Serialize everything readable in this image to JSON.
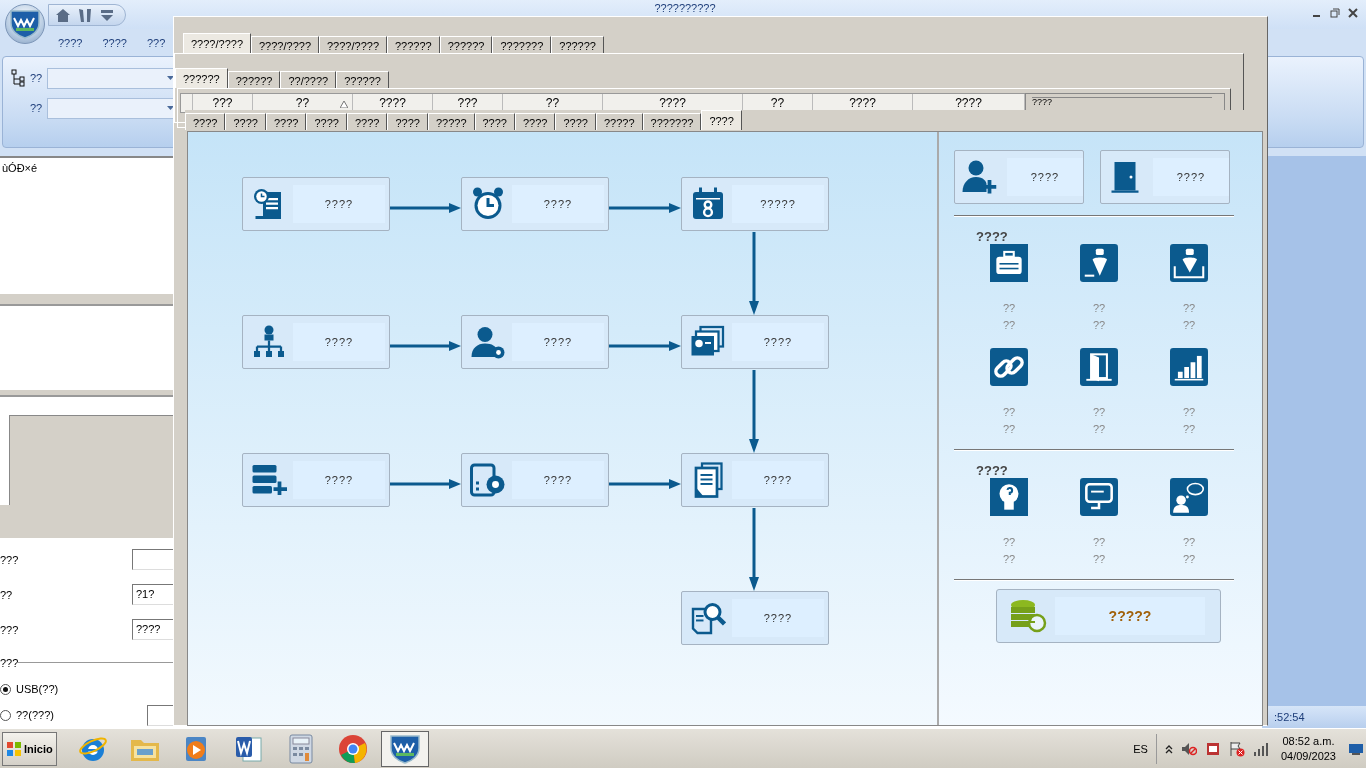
{
  "app": {
    "title": "??????????",
    "menu_tabs": [
      "????",
      "????",
      "???"
    ],
    "ribbon_fields": [
      {
        "label": "??"
      },
      {
        "label": "??"
      }
    ],
    "list_text": "ùÓĐ×é",
    "form_rows": [
      {
        "label": "???"
      },
      {
        "label": "??",
        "value": "?1?"
      },
      {
        "label": "???",
        "value": "????"
      }
    ],
    "radio_group": {
      "title": "???",
      "options": [
        {
          "label": "USB(??)",
          "selected": true
        },
        {
          "label": "??(???)",
          "selected": false
        }
      ]
    },
    "status_time": ":52:54"
  },
  "dialog": {
    "tabs": [
      {
        "label": "????/????",
        "selected": true
      },
      {
        "label": "????/????",
        "selected": false
      },
      {
        "label": "????/????",
        "selected": false
      },
      {
        "label": "??????",
        "selected": false
      },
      {
        "label": "??????",
        "selected": false
      },
      {
        "label": "???????",
        "selected": false
      },
      {
        "label": "??????",
        "selected": false
      }
    ],
    "subtabs": [
      {
        "label": "??????",
        "selected": true
      },
      {
        "label": "??????",
        "selected": false
      },
      {
        "label": "??/????",
        "selected": false
      },
      {
        "label": "??????",
        "selected": false
      }
    ],
    "grid_columns": [
      {
        "label": "???",
        "sorted": false
      },
      {
        "label": "??",
        "sorted": true
      },
      {
        "label": "????",
        "sorted": false
      },
      {
        "label": "???",
        "sorted": false
      },
      {
        "label": "??",
        "sorted": false
      },
      {
        "label": "????",
        "sorted": false
      },
      {
        "label": "??",
        "sorted": false
      },
      {
        "label": "????",
        "sorted": false
      },
      {
        "label": "????",
        "sorted": false
      }
    ],
    "group_label": "????",
    "page_tabs": [
      {
        "label": "????",
        "selected": false
      },
      {
        "label": "????",
        "selected": false
      },
      {
        "label": "????",
        "selected": false
      },
      {
        "label": "????",
        "selected": false
      },
      {
        "label": "????",
        "selected": false
      },
      {
        "label": "????",
        "selected": false
      },
      {
        "label": "?????",
        "selected": false
      },
      {
        "label": "????",
        "selected": false
      },
      {
        "label": "????",
        "selected": false
      },
      {
        "label": "????",
        "selected": false
      },
      {
        "label": "?????",
        "selected": false
      },
      {
        "label": "???????",
        "selected": false
      },
      {
        "label": "????",
        "selected": true
      }
    ],
    "flow_nodes": [
      {
        "kind": "clock-scroll",
        "label": "????"
      },
      {
        "kind": "alarm",
        "label": "????"
      },
      {
        "kind": "calendar",
        "label": "?????"
      },
      {
        "kind": "org",
        "label": "????"
      },
      {
        "kind": "user-gear",
        "label": "????"
      },
      {
        "kind": "id-cards",
        "label": "????"
      },
      {
        "kind": "server-add",
        "label": "????"
      },
      {
        "kind": "calc-gear",
        "label": "????"
      },
      {
        "kind": "documents",
        "label": "????"
      },
      {
        "kind": "doc-search",
        "label": "????"
      }
    ],
    "quick_buttons": [
      {
        "kind": "user-add",
        "label": "????"
      },
      {
        "kind": "door",
        "label": "????"
      }
    ],
    "sections": [
      {
        "title": "????",
        "items": [
          {
            "kind": "briefcase",
            "lines": [
              "??",
              "??"
            ]
          },
          {
            "kind": "pen",
            "lines": [
              "??",
              "??"
            ]
          },
          {
            "kind": "pen-doc",
            "lines": [
              "??",
              "??"
            ]
          },
          {
            "kind": "link",
            "lines": [
              "??",
              "??"
            ]
          },
          {
            "kind": "door-tile",
            "lines": [
              "??",
              "??"
            ]
          },
          {
            "kind": "chart",
            "lines": [
              "??",
              "??"
            ]
          }
        ]
      },
      {
        "title": "????",
        "items": [
          {
            "kind": "bulb",
            "lines": [
              "??",
              "??"
            ]
          },
          {
            "kind": "monitor",
            "lines": [
              "??",
              "??"
            ]
          },
          {
            "kind": "user-chat",
            "lines": [
              "??",
              "??"
            ]
          }
        ]
      }
    ],
    "backup_button": {
      "label": "?????"
    }
  },
  "taskbar": {
    "start": "Inicio",
    "apps": [
      {
        "kind": "ie",
        "selected": false
      },
      {
        "kind": "folder",
        "selected": false
      },
      {
        "kind": "media",
        "selected": false
      },
      {
        "kind": "word",
        "selected": false
      },
      {
        "kind": "calculator",
        "selected": false
      },
      {
        "kind": "chrome",
        "selected": false
      },
      {
        "kind": "shield",
        "selected": true
      }
    ],
    "language": "ES",
    "time": "08:52 a.m.",
    "date": "04/09/2023"
  }
}
